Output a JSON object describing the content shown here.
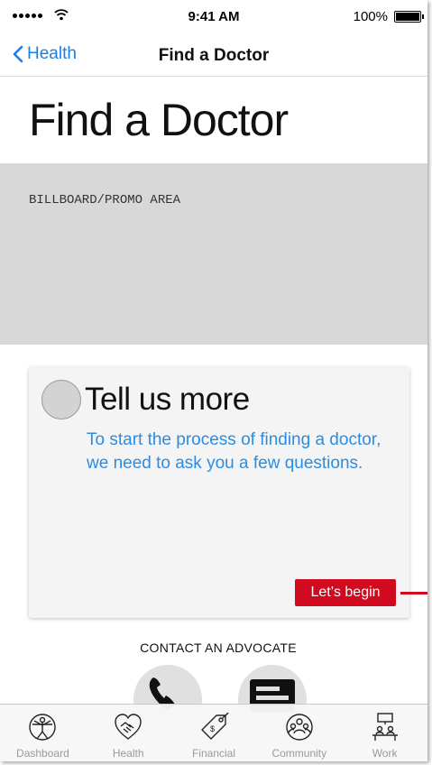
{
  "status_bar": {
    "time": "9:41 AM",
    "battery": "100%"
  },
  "nav": {
    "back_label": "Health",
    "title": "Find a Doctor"
  },
  "page": {
    "title": "Find a Doctor"
  },
  "billboard": {
    "text": "BILLBOARD/PROMO AREA"
  },
  "card": {
    "title": "Tell us more",
    "body": "To start the process of finding a doctor, we need to ask you a few questions.",
    "button_label": "Let’s begin"
  },
  "contact": {
    "label": "CONTACT AN ADVOCATE"
  },
  "tabs": [
    {
      "label": "Dashboard",
      "icon": "vitruvian-icon"
    },
    {
      "label": "Health",
      "icon": "handshake-heart-icon"
    },
    {
      "label": "Financial",
      "icon": "price-tag-icon"
    },
    {
      "label": "Community",
      "icon": "people-group-icon"
    },
    {
      "label": "Work",
      "icon": "meeting-table-icon"
    }
  ],
  "colors": {
    "accent_blue": "#1a7fe0",
    "body_blue": "#2a8de3",
    "brand_red": "#d10a1f",
    "billboard_gray": "#d8d8d8"
  }
}
